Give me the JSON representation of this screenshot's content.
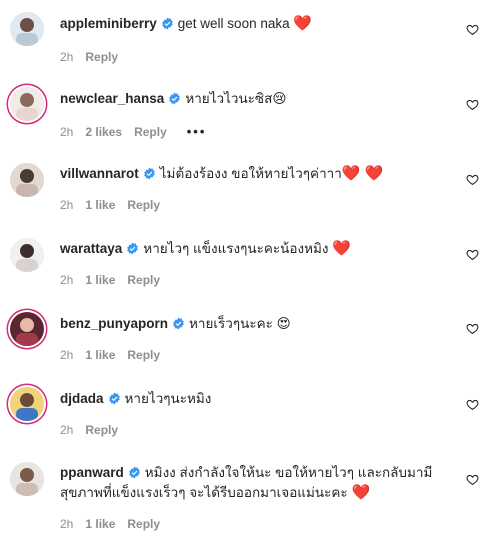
{
  "comments": [
    {
      "username": "appleminiberry",
      "text": "get well soon naka",
      "emoji": "❤️",
      "time": "2h",
      "likes": "",
      "reply": "Reply"
    },
    {
      "username": "newclear_hansa",
      "text": "หายไวไวนะซิส",
      "emoji": "😢",
      "time": "2h",
      "likes": "2 likes",
      "reply": "Reply",
      "more": "•••"
    },
    {
      "username": "villwannarot",
      "text": "ไม่ต้องร้องง ขอให้หายไวๆค่าาา",
      "emoji": "❤️ ❤️",
      "time": "2h",
      "likes": "1 like",
      "reply": "Reply"
    },
    {
      "username": "warattaya",
      "text": "หายไวๆ แข็งแรงๆนะคะน้องหมิง",
      "emoji": "❤️",
      "time": "2h",
      "likes": "1 like",
      "reply": "Reply"
    },
    {
      "username": "benz_punyaporn",
      "text": "หายเร็วๆนะคะ",
      "emoji": "😍",
      "time": "2h",
      "likes": "1 like",
      "reply": "Reply"
    },
    {
      "username": "djdada",
      "text": "หายไวๆนะหมิง",
      "emoji": "",
      "time": "2h",
      "likes": "",
      "reply": "Reply"
    },
    {
      "username": "ppanward",
      "text": "หมิงง ส่งกำลังใจให้นะ ขอให้หายไวๆ และกลับมามีสุขภาพที่แข็งแรงเร็วๆ จะได้รีบออกมาเจอแม่นะคะ",
      "emoji": "❤️",
      "time": "2h",
      "likes": "1 like",
      "reply": "Reply"
    }
  ],
  "icons": {
    "verified": "verified-badge-icon",
    "like": "heart-outline-icon"
  },
  "colors": {
    "verified": "#3897f0",
    "meta": "#8e8e8e",
    "heart": "#e0213a",
    "ring": "#d62976"
  }
}
